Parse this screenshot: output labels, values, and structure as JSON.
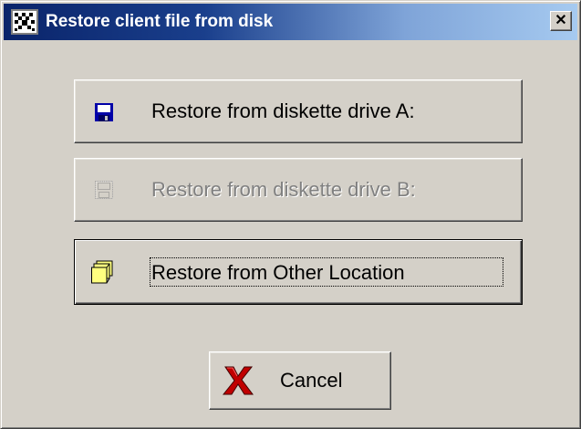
{
  "window": {
    "title": "Restore client file from disk",
    "close_glyph": "✕"
  },
  "buttons": {
    "drive_a": {
      "label": "Restore from diskette drive A:",
      "icon": "floppy-disk-icon",
      "enabled": true
    },
    "drive_b": {
      "label": "Restore from diskette drive B:",
      "icon": "floppy-disk-icon",
      "enabled": false
    },
    "other_location": {
      "label": "Restore from Other Location",
      "icon": "folder-icon",
      "enabled": true,
      "focused": true
    },
    "cancel": {
      "label": "Cancel",
      "icon": "red-x-icon"
    }
  },
  "colors": {
    "face": "#d4d0c8",
    "title_start": "#0a246a",
    "title_end": "#a6caf0",
    "floppy": "#0000a8",
    "folder": "#ffff80",
    "cancel_x": "#c00000"
  }
}
